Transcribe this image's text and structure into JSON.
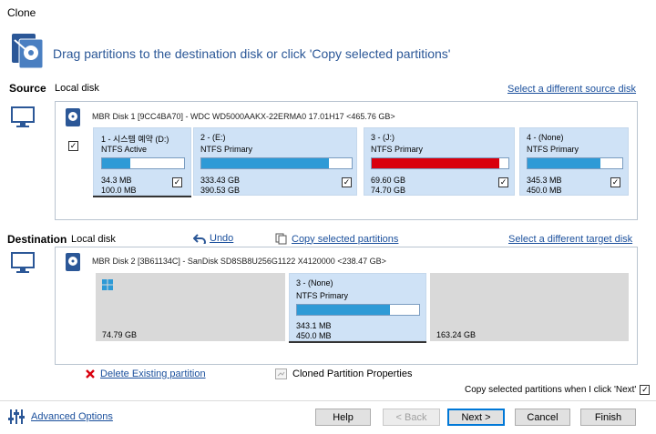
{
  "window": {
    "title": "Clone"
  },
  "instruction": "Drag partitions to the destination disk or click 'Copy selected partitions'",
  "source": {
    "label": "Source",
    "disk_type": "Local disk",
    "select_link": "Select a different source disk",
    "disk_header": "MBR Disk 1 [9CC4BA70] - WDC WD5000AAKX-22ERMA0 17.01H17  <465.76 GB>",
    "disk_checked": true,
    "partitions": [
      {
        "title": "1 - 시스템 예약 (D:)",
        "fs": "NTFS Active",
        "used": "34.3 MB",
        "total": "100.0 MB",
        "fill": 0.34,
        "checked": true,
        "color": "#2e9ad6"
      },
      {
        "title": "2 - (E:)",
        "fs": "NTFS Primary",
        "used": "333.43 GB",
        "total": "390.53 GB",
        "fill": 0.85,
        "checked": true,
        "color": "#2e9ad6"
      },
      {
        "title": "3 - (J:)",
        "fs": "NTFS Primary",
        "used": "69.60 GB",
        "total": "74.70 GB",
        "fill": 0.93,
        "checked": true,
        "color": "#d9000d"
      },
      {
        "title": "4 - (None)",
        "fs": "NTFS Primary",
        "used": "345.3 MB",
        "total": "450.0 MB",
        "fill": 0.77,
        "checked": true,
        "color": "#2e9ad6"
      }
    ]
  },
  "destination": {
    "label": "Destination",
    "disk_type": "Local disk",
    "undo": "Undo",
    "copy_selected": "Copy selected partitions",
    "select_link": "Select a different target disk",
    "disk_header": "MBR Disk 2 [3B61134C] - SanDisk SD8SB8U256G1122 X4120000  <238.47 GB>",
    "partitions": [
      {
        "size": "74.79 GB"
      },
      {
        "title": "3 - (None)",
        "fs": "NTFS Primary",
        "used": "343.1 MB",
        "total": "450.0 MB",
        "fill": 0.76
      },
      {
        "size": "163.24 GB"
      }
    ]
  },
  "actions": {
    "delete": "Delete Existing partition",
    "cloned_props": "Cloned Partition Properties",
    "copy_when_next": "Copy selected partitions when I click 'Next'",
    "copy_when_next_checked": true
  },
  "footer": {
    "advanced": "Advanced Options",
    "buttons": {
      "help": "Help",
      "back": "< Back",
      "next": "Next >",
      "cancel": "Cancel",
      "finish": "Finish"
    }
  },
  "colors": {
    "accent": "#2b5797",
    "bar_blue": "#2e9ad6",
    "bar_red": "#d9000d",
    "partition_bg": "#cfe2f6",
    "unallocated": "#d9d9d9"
  }
}
